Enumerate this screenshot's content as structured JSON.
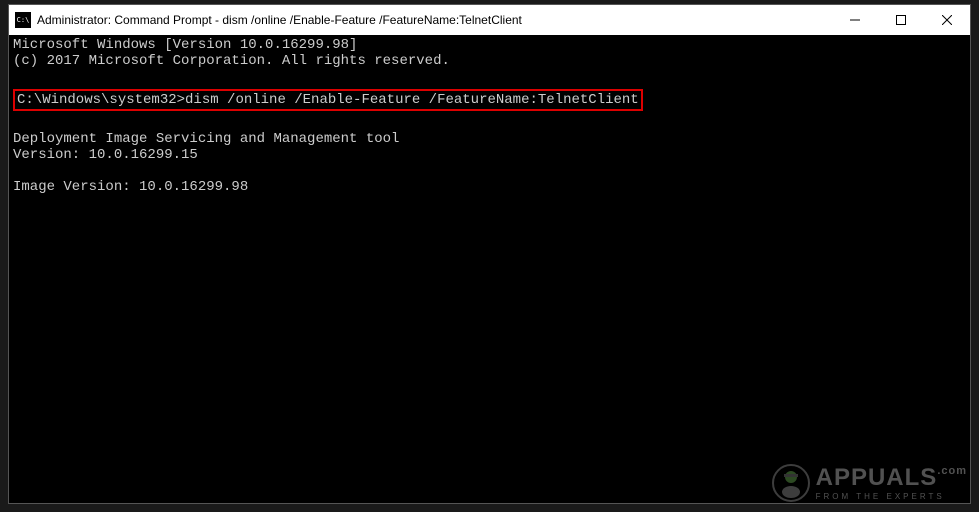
{
  "window": {
    "title": "Administrator: Command Prompt - dism  /online /Enable-Feature /FeatureName:TelnetClient"
  },
  "terminal": {
    "line1": "Microsoft Windows [Version 10.0.16299.98]",
    "line2": "(c) 2017 Microsoft Corporation. All rights reserved.",
    "prompt": "C:\\Windows\\system32>",
    "command": "dism /online /Enable-Feature /FeatureName:TelnetClient",
    "output1": "Deployment Image Servicing and Management tool",
    "output2": "Version: 10.0.16299.15",
    "output3": "Image Version: 10.0.16299.98"
  },
  "watermark": {
    "brand": "APPUALS",
    "tagline": "FROM THE EXPERTS",
    "dotcom": ".com"
  }
}
